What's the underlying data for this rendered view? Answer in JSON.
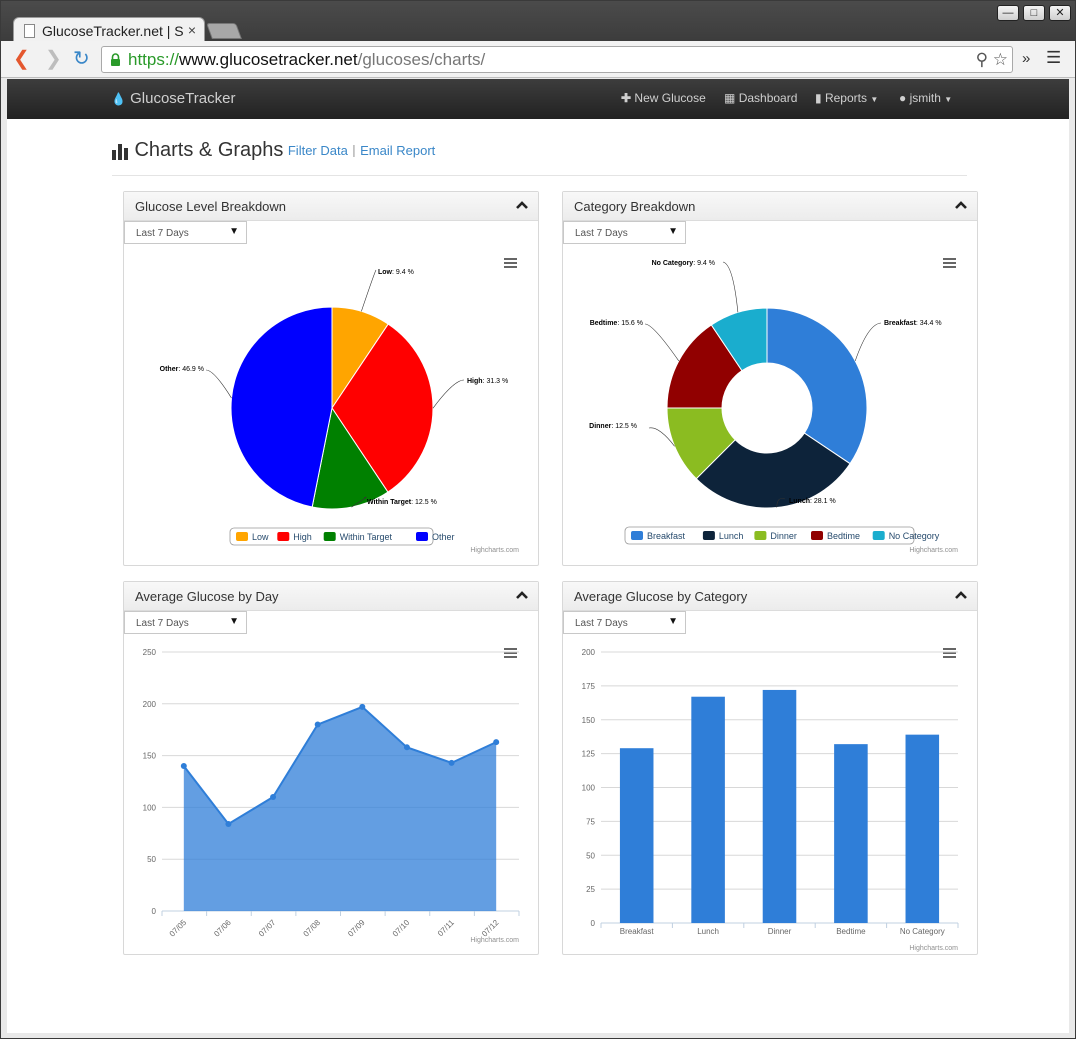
{
  "browser": {
    "tab_title": "GlucoseTracker.net | S",
    "tab_close": "×",
    "url_scheme": "https://",
    "url_host": "www.glucosetracker.net",
    "url_path": "/glucoses/charts/",
    "window_controls": [
      "minimize-icon",
      "maximize-icon",
      "close-icon"
    ],
    "extensions_label": "»"
  },
  "navbar": {
    "brand": "GlucoseTracker",
    "items": [
      {
        "label": "New Glucose",
        "icon": "plus-icon"
      },
      {
        "label": "Dashboard",
        "icon": "grid-icon"
      },
      {
        "label": "Reports",
        "icon": "bar-chart-icon",
        "caret": true
      },
      {
        "label": "jsmith",
        "icon": "user-icon",
        "caret": true
      }
    ]
  },
  "header": {
    "title": "Charts & Graphs",
    "filter_link": "Filter Data",
    "separator": "|",
    "email_link": "Email Report"
  },
  "panels": {
    "level": {
      "title": "Glucose Level Breakdown",
      "range": "Last 7 Days"
    },
    "category": {
      "title": "Category Breakdown",
      "range": "Last 7 Days"
    },
    "day": {
      "title": "Average Glucose by Day",
      "range": "Last 7 Days"
    },
    "avgcat": {
      "title": "Average Glucose by Category",
      "range": "Last 7 Days"
    }
  },
  "credits": "Highcharts.com",
  "colors": {
    "low": "#FFA500",
    "high": "#FF0000",
    "within": "#008000",
    "other": "#0000FF",
    "breakfast": "#2F7ED8",
    "lunch": "#0D233A",
    "dinner": "#8BBC21",
    "bedtime": "#910000",
    "no_category": "#1AADCE",
    "area": "#2F7ED8",
    "bar": "#2F7ED8"
  },
  "chart_data": [
    {
      "type": "pie",
      "slices": [
        {
          "name": "Low",
          "value": 9.4,
          "label": "9.4 %"
        },
        {
          "name": "High",
          "value": 31.3,
          "label": "31.3 %"
        },
        {
          "name": "Within Target",
          "value": 12.5,
          "label": "12.5 %"
        },
        {
          "name": "Other",
          "value": 46.9,
          "label": "46.9 %"
        }
      ],
      "legend": "bottom-center"
    },
    {
      "type": "pie",
      "donut": true,
      "slices": [
        {
          "name": "Breakfast",
          "value": 34.4,
          "label": "34.4 %"
        },
        {
          "name": "Lunch",
          "value": 28.1,
          "label": "28.1 %"
        },
        {
          "name": "Dinner",
          "value": 12.5,
          "label": "12.5 %"
        },
        {
          "name": "Bedtime",
          "value": 15.6,
          "label": "15.6 %"
        },
        {
          "name": "No Category",
          "value": 9.4,
          "label": "9.4 %"
        }
      ],
      "legend": "bottom-center"
    },
    {
      "type": "area",
      "categories": [
        "07/05",
        "07/06",
        "07/07",
        "07/08",
        "07/09",
        "07/10",
        "07/11",
        "07/12"
      ],
      "values": [
        140,
        84,
        110,
        180,
        197,
        158,
        143,
        163
      ],
      "ylim": [
        0,
        250
      ],
      "yticks": [
        0,
        50,
        100,
        150,
        200,
        250
      ],
      "grid": true
    },
    {
      "type": "bar",
      "categories": [
        "Breakfast",
        "Lunch",
        "Dinner",
        "Bedtime",
        "No Category"
      ],
      "values": [
        129,
        167,
        172,
        132,
        139
      ],
      "ylim": [
        0,
        200
      ],
      "yticks": [
        0,
        25,
        50,
        75,
        100,
        125,
        150,
        175,
        200
      ],
      "grid": true
    }
  ]
}
